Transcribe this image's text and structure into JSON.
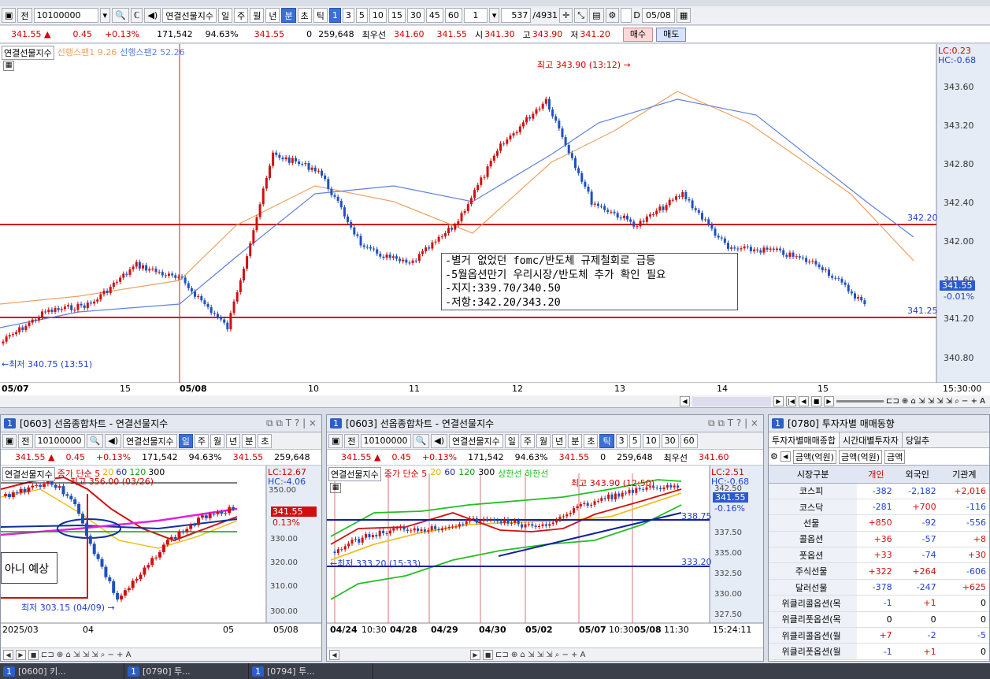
{
  "toolbar": {
    "jeon": "전",
    "code": "10100000",
    "symbol": "연결선물지수",
    "periods": [
      "일",
      "주",
      "월",
      "년",
      "분",
      "초",
      "틱"
    ],
    "nums": [
      "1",
      "3",
      "5",
      "10",
      "15",
      "30",
      "45",
      "60"
    ],
    "unit": "1",
    "count": "537",
    "total": "/4931",
    "date": "05/08"
  },
  "quote": {
    "price": "341.55 ▲",
    "change": "0.45",
    "pct": "+0.13%",
    "volume": "171,542",
    "ratio": "94.63%",
    "p2": "341.55",
    "zero": "0",
    "oi": "259,648",
    "best_label": "최우선",
    "bid": "341.60",
    "ask": "341.55",
    "open_label": "시",
    "open": "341.30",
    "high_label": "고",
    "high": "343.90",
    "low_label": "저",
    "low": "341.20",
    "buy": "매수",
    "sell": "매도"
  },
  "main": {
    "legend_symbol": "연결선물지수",
    "legend_span1": "선행스팬1 9.26",
    "legend_span2": "선행스팬2 52.26",
    "lc": "LC:0.23",
    "hc": "HC:-0.68",
    "high_note": "최고 343.90 (13:12) →",
    "low_note": "←최저 340.75 (13:51)",
    "annotation": [
      "-별거 없었던 fomc/반도체 규제철회로 급등",
      "-5월옵션만기 우리시장/반도체 추가 확인 필요",
      "-지지:339.70/340.50",
      "-저항:342.20/343.20"
    ],
    "price_box": "341.55",
    "pct_box": "-0.01%",
    "line_upper": "342.20",
    "line_lower": "341.25",
    "x_labels": [
      "05/07",
      "15",
      "05/08",
      "10",
      "11",
      "12",
      "13",
      "14",
      "15"
    ],
    "time": "15:30:00",
    "y_ticks": [
      "343.60",
      "343.20",
      "342.80",
      "342.40",
      "342.00",
      "341.60",
      "341.20",
      "340.80"
    ]
  },
  "p1": {
    "num": "1",
    "title": "[0603] 선옵종합차트 - 연결선물지수",
    "legend": "연결선물지수",
    "ma": "종가 단순 5",
    "ma2": "20",
    "ma3": "60",
    "ma4": "120",
    "ma5": "300",
    "lc": "LC:12.67",
    "hc": "HC:-4.06",
    "high_note": "최고 356.00 (03/26)",
    "low_note": "최저 303.15 (04/09) →",
    "memo": "아니 예상",
    "price": "341.55",
    "pct": "0.13%",
    "y": [
      "350.00",
      "340.00",
      "330.00",
      "320.00",
      "310.00",
      "300.00"
    ],
    "x": [
      "2025/03",
      "04",
      "05",
      "05/08"
    ]
  },
  "p2": {
    "num": "1",
    "title": "[0603] 선옵종합차트 - 연결선물지수",
    "legend": "연결선물지수",
    "ma": "종가 단순 5",
    "ma2": "20",
    "ma3": "60",
    "ma4": "120",
    "ma5": "300",
    "band": "상한선 하한선",
    "lc": "LC:2.51",
    "hc": "HC:-0.68",
    "high_note": "최고 343.90 (12:50)",
    "low_note": "←최저 333.20 (15:33)",
    "price": "341.55",
    "pct": "-0.16%",
    "lvl1": "338.75",
    "lvl2": "333.20",
    "y": [
      "342.50",
      "340.00",
      "337.50",
      "335.00",
      "332.50",
      "330.00",
      "327.50"
    ],
    "x": [
      "04/24",
      "10:30",
      "04/28",
      "04/29",
      "04/30",
      "05/02",
      "05/07",
      "10:30",
      "05/08",
      "11:30",
      "15:24:11"
    ]
  },
  "p3": {
    "num": "1",
    "title": "[0780] 투자자별 매매동향",
    "tabs": [
      "투자자별매매종합",
      "시간대별투자자",
      "당일추"
    ],
    "opt1": "금액(억원)",
    "opt2": "금액(억원)",
    "opt3": "금액",
    "headers": [
      "시장구분",
      "개인",
      "외국인",
      "기관계"
    ],
    "rows": [
      [
        "코스피",
        "-382",
        "-2,182",
        "+2,016"
      ],
      [
        "코스닥",
        "-281",
        "+700",
        "-116"
      ],
      [
        "선물",
        "+850",
        "-92",
        "-556"
      ],
      [
        "콜옵션",
        "+36",
        "-57",
        "+8"
      ],
      [
        "풋옵션",
        "+33",
        "-74",
        "+30"
      ],
      [
        "주식선물",
        "+322",
        "+264",
        "-606"
      ],
      [
        "달러선물",
        "-378",
        "-247",
        "+625"
      ],
      [
        "위클리콜옵션(목",
        "-1",
        "+1",
        "0"
      ],
      [
        "위클리풋옵션(목",
        "0",
        "0",
        "0"
      ],
      [
        "위클리콜옵션(월",
        "+7",
        "-2",
        "-5"
      ],
      [
        "위클리풋옵션(월",
        "-1",
        "+1",
        "0"
      ]
    ]
  },
  "tasks": [
    "[0600] 키...",
    "[0790] 투...",
    "[0794] 투..."
  ]
}
